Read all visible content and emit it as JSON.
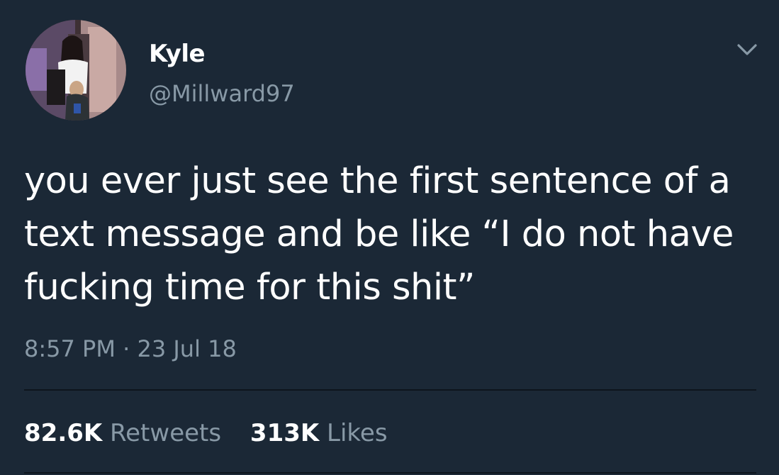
{
  "user": {
    "display_name": "Kyle",
    "handle": "@Millward97"
  },
  "tweet": {
    "text": "you ever just see the first sentence of a text message and be like “I do not have fucking time for this shit”",
    "timestamp": "8:57 PM · 23 Jul 18"
  },
  "stats": {
    "retweets_count": "82.6K",
    "retweets_label": "Retweets",
    "likes_count": "313K",
    "likes_label": "Likes"
  },
  "icons": {
    "menu": "chevron-down-icon"
  },
  "colors": {
    "background": "#1b2836",
    "primary_text": "#ffffff",
    "secondary_text": "#8899a6",
    "divider": "#0e151d"
  }
}
